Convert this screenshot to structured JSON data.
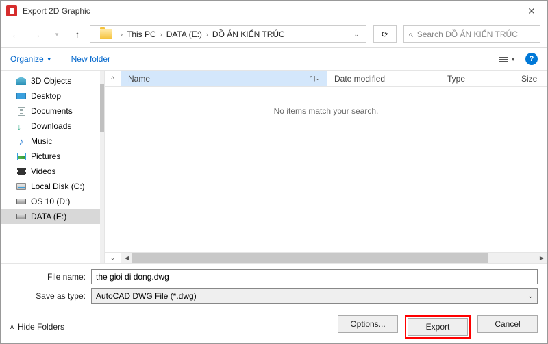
{
  "window": {
    "title": "Export 2D Graphic"
  },
  "breadcrumb": {
    "part1": "This PC",
    "part2": "DATA (E:)",
    "part3": "ĐỒ ÁN KIẾN TRÚC"
  },
  "search": {
    "placeholder": "Search ĐỒ ÁN KIẾN TRÚC"
  },
  "toolbar": {
    "organize": "Organize",
    "newfolder": "New folder"
  },
  "sidebar": {
    "items": [
      {
        "label": "3D Objects"
      },
      {
        "label": "Desktop"
      },
      {
        "label": "Documents"
      },
      {
        "label": "Downloads"
      },
      {
        "label": "Music"
      },
      {
        "label": "Pictures"
      },
      {
        "label": "Videos"
      },
      {
        "label": "Local Disk (C:)"
      },
      {
        "label": "OS 10 (D:)"
      },
      {
        "label": "DATA (E:)"
      }
    ]
  },
  "columns": {
    "name": "Name",
    "date": "Date modified",
    "type": "Type",
    "size": "Size"
  },
  "content": {
    "empty": "No items match your search."
  },
  "fields": {
    "filename_label": "File name:",
    "filename_value": "the gioi di dong.dwg",
    "saveas_label": "Save as type:",
    "saveas_value": "AutoCAD DWG File (*.dwg)"
  },
  "footer": {
    "hide": "Hide Folders",
    "options": "Options...",
    "export": "Export",
    "cancel": "Cancel"
  }
}
